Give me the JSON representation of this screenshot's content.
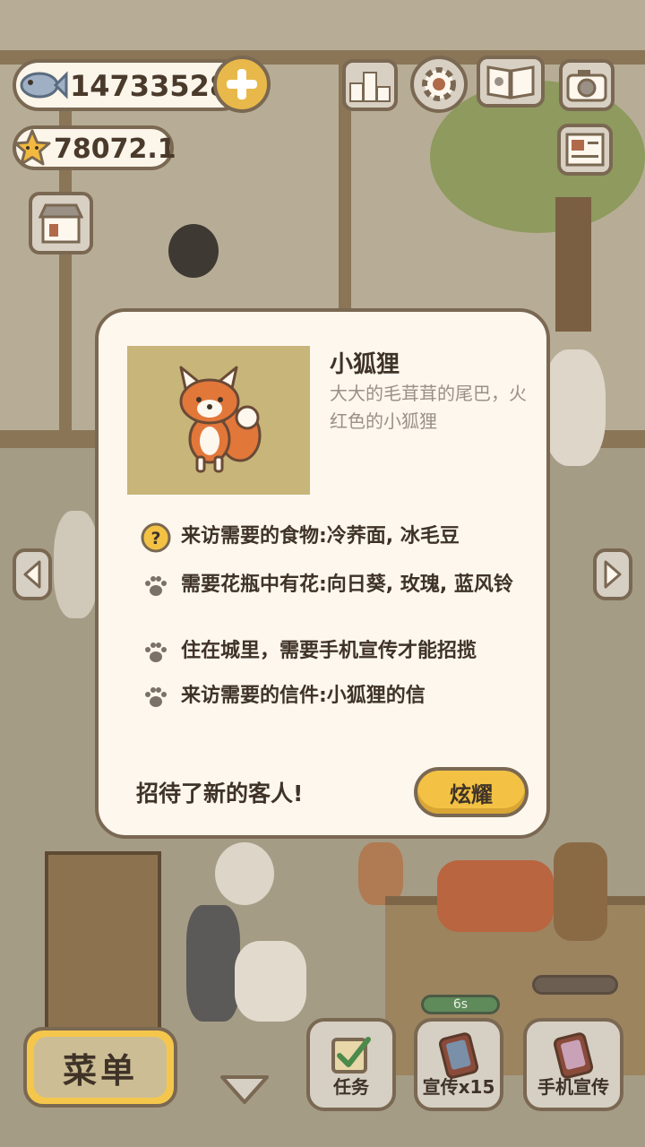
{
  "hud": {
    "fish_count": "14733528",
    "star_count": "78072.1",
    "icons": [
      "fish-icon",
      "plus-icon",
      "star-icon",
      "shop-icon",
      "ranking-icon",
      "settings-icon",
      "album-icon",
      "camera-icon",
      "newspaper-icon"
    ]
  },
  "modal": {
    "character_name": "小狐狸",
    "character_description": "大大的毛茸茸的尾巴，火红色的小狐狸",
    "requirements": [
      {
        "icon": "question-icon",
        "text": "来访需要的食物:冷荞面, 冰毛豆"
      },
      {
        "icon": "paw-icon",
        "text": "需要花瓶中有花:向日葵, 玫瑰, 蓝风铃"
      },
      {
        "icon": "paw-icon",
        "text": "住在城里，需要手机宣传才能招揽"
      },
      {
        "icon": "paw-icon",
        "text": "来访需要的信件:小狐狸的信"
      }
    ],
    "footer_message": "招待了新的客人!",
    "show_off_label": "炫耀"
  },
  "bottom_bar": {
    "menu_label": "菜单",
    "task_label": "任务",
    "promo_label": "宣传x15",
    "phone_promo_label": "手机宣传",
    "timer_text": "6s"
  },
  "colors": {
    "outline": "#7a6852",
    "button_yellow": "#f3c244",
    "modal_bg": "#fdf7ee",
    "portrait_bg": "#c7b57a",
    "fox_orange": "#e2773a"
  }
}
